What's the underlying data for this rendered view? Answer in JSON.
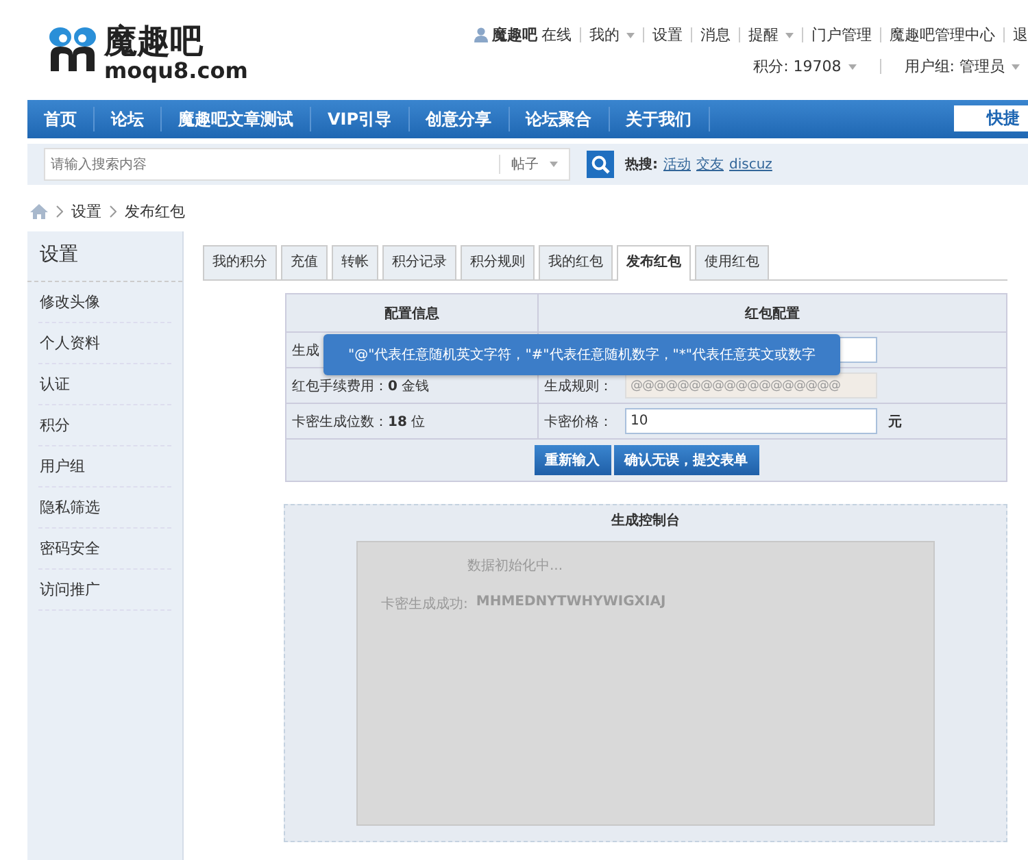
{
  "logo": {
    "name": "魔趣吧",
    "domain": "moqu8.com"
  },
  "user_bar": {
    "username": "魔趣吧",
    "status": "在线",
    "links": [
      {
        "label": "我的",
        "dropdown": true
      },
      {
        "label": "设置",
        "dropdown": false
      },
      {
        "label": "消息",
        "dropdown": false
      },
      {
        "label": "提醒",
        "dropdown": true
      },
      {
        "label": "门户管理",
        "dropdown": false
      },
      {
        "label": "魔趣吧管理中心",
        "dropdown": false
      },
      {
        "label": "退",
        "dropdown": false
      }
    ],
    "info": [
      {
        "label": "积分: 19708",
        "dropdown": true
      },
      {
        "label": "用户组: 管理员",
        "dropdown": true
      }
    ]
  },
  "nav": {
    "items": [
      {
        "label": "首页"
      },
      {
        "label": "论坛"
      },
      {
        "label": "魔趣吧文章测试"
      },
      {
        "label": "VIP引导"
      },
      {
        "label": "创意分享"
      },
      {
        "label": "论坛聚合"
      },
      {
        "label": "关于我们"
      }
    ],
    "quick": "快捷"
  },
  "search": {
    "placeholder": "请输入搜索内容",
    "type": "帖子",
    "hot_label": "热搜:",
    "hot": [
      "活动",
      "交友",
      "discuz"
    ]
  },
  "breadcrumb": [
    "设置",
    "发布红包"
  ],
  "sidebar": {
    "title": "设置",
    "items": [
      {
        "label": "修改头像"
      },
      {
        "label": "个人资料"
      },
      {
        "label": "认证"
      },
      {
        "label": "积分"
      },
      {
        "label": "用户组"
      },
      {
        "label": "隐私筛选"
      },
      {
        "label": "密码安全"
      },
      {
        "label": "访问推广"
      }
    ]
  },
  "tabs": [
    {
      "label": "我的积分",
      "selected": false
    },
    {
      "label": "充值",
      "selected": false
    },
    {
      "label": "转帐",
      "selected": false
    },
    {
      "label": "积分记录",
      "selected": false
    },
    {
      "label": "积分规则",
      "selected": false
    },
    {
      "label": "我的红包",
      "selected": false
    },
    {
      "label": "发布红包",
      "selected": true
    },
    {
      "label": "使用红包",
      "selected": false
    }
  ],
  "form": {
    "columns": [
      "配置信息",
      "红包配置"
    ],
    "rows": [
      {
        "left": "生成",
        "right_label": "",
        "right_value": "",
        "readonly": false
      },
      {
        "left": "红包手续费用：**0** 金钱",
        "right_label": "生成规则：",
        "right_value": "@@@@@@@@@@@@@@@@@@",
        "readonly": true
      },
      {
        "left": "卡密生成位数：**18** 位",
        "right_label": "卡密价格：",
        "right_value": "10",
        "readonly": false,
        "unit": "元"
      }
    ],
    "buttons": [
      "重新输入",
      "确认无误，提交表单"
    ],
    "tooltip": "\"@\"代表任意随机英文字符，\"#\"代表任意随机数字，\"*\"代表任意英文或数字"
  },
  "console": {
    "title": "生成控制台",
    "status": "数据初始化中...",
    "result_label": "卡密生成成功:",
    "result_value": "MHMEDNYTWHYWIGXIAJ"
  }
}
